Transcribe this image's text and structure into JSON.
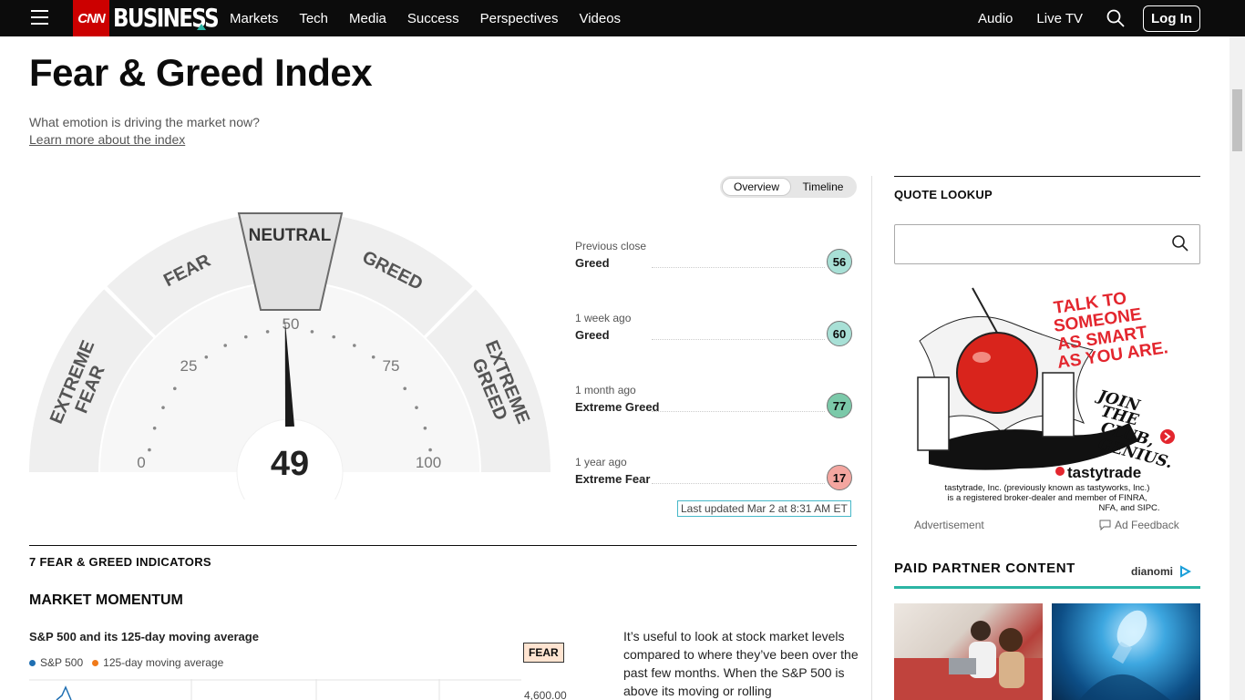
{
  "nav": {
    "brand": "CNN",
    "section": "BUSINESS",
    "links": [
      "Markets",
      "Tech",
      "Media",
      "Success",
      "Perspectives",
      "Videos"
    ],
    "right_links": [
      "Audio",
      "Live TV"
    ],
    "login_label": "Log In"
  },
  "page": {
    "title": "Fear & Greed Index",
    "subtitle": "What emotion is driving the market now?",
    "learn_link": "Learn more about the index"
  },
  "toggle": {
    "overview": "Overview",
    "timeline": "Timeline",
    "active": "Overview"
  },
  "gauge": {
    "value": 49,
    "value_label": "49",
    "zones": [
      "EXTREME FEAR",
      "FEAR",
      "NEUTRAL",
      "GREED",
      "EXTREME GREED"
    ],
    "ticks": [
      "0",
      "25",
      "50",
      "75",
      "100"
    ]
  },
  "history": [
    {
      "when": "Previous close",
      "rating": "Greed",
      "score": "56",
      "color": "#a8e0d6"
    },
    {
      "when": "1 week ago",
      "rating": "Greed",
      "score": "60",
      "color": "#a8e0d6"
    },
    {
      "when": "1 month ago",
      "rating": "Extreme Greed",
      "score": "77",
      "color": "#7bc9a9"
    },
    {
      "when": "1 year ago",
      "rating": "Extreme Fear",
      "score": "17",
      "color": "#f4a6a0"
    }
  ],
  "last_updated": "Last updated Mar 2 at 8:31 AM ET",
  "indicators": {
    "heading": "7 FEAR & GREED INDICATORS",
    "section": "MARKET MOMENTUM",
    "chart_title": "S&P 500 and its 125-day moving average",
    "legend": [
      {
        "label": "S&P 500",
        "color": "#1f6fb2"
      },
      {
        "label": "125-day moving average",
        "color": "#f07a1a"
      }
    ],
    "badge": "FEAR",
    "axis_label": "4,600.00",
    "body": "It’s useful to look at stock market levels compared to where they’ve been over the past few months. When the S&P 500 is above its moving or rolling"
  },
  "sidebar": {
    "quote_title": "QUOTE LOOKUP",
    "ad": {
      "headline": "TALK TO SOMEONE AS SMART AS YOU ARE.",
      "join": "JOIN THE CLUB, GENIUS.",
      "brand": "tastytrade",
      "disclaimer": "tastytrade, Inc. (previously known as tastyworks, Inc.) is a registered broker-dealer and member of FINRA, NFA, and SIPC."
    },
    "ad_label": "Advertisement",
    "ad_feedback": "Ad Feedback",
    "ppc_title": "PAID PARTNER CONTENT",
    "ppc_brand": "dianomi"
  },
  "colors": {
    "brand_red": "#cc0000",
    "accent_teal": "#2bb5a4"
  }
}
